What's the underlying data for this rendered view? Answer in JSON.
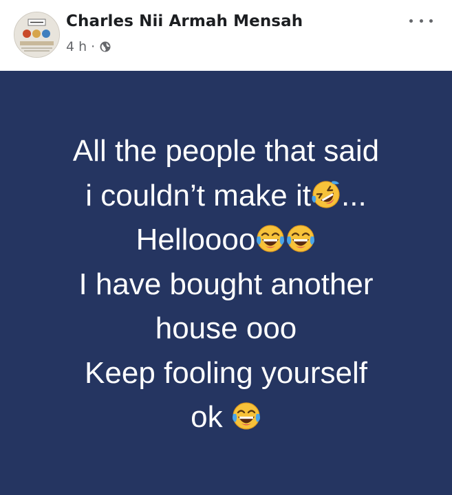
{
  "post": {
    "author": "Charles Nii Armah Mensah",
    "time": "4 h",
    "separator": "·",
    "privacy_icon": "globe-icon",
    "more_icon": "more-horizontal-icon"
  },
  "body": {
    "background_color": "#253561",
    "text_color": "#ffffff",
    "lines": [
      {
        "text": "All the people that said"
      },
      {
        "text": "i couldn’t make it",
        "emoji_after": [
          "rolling-on-floor-laughing"
        ],
        "suffix": "..."
      },
      {
        "text": "Helloooo",
        "emoji_after": [
          "face-with-tears-of-joy",
          "face-with-tears-of-joy"
        ]
      },
      {
        "text": "I have bought another"
      },
      {
        "text": "house ooo"
      },
      {
        "text": "Keep fooling yourself"
      },
      {
        "text": "ok ",
        "emoji_after": [
          "face-with-tears-of-joy"
        ]
      }
    ]
  }
}
